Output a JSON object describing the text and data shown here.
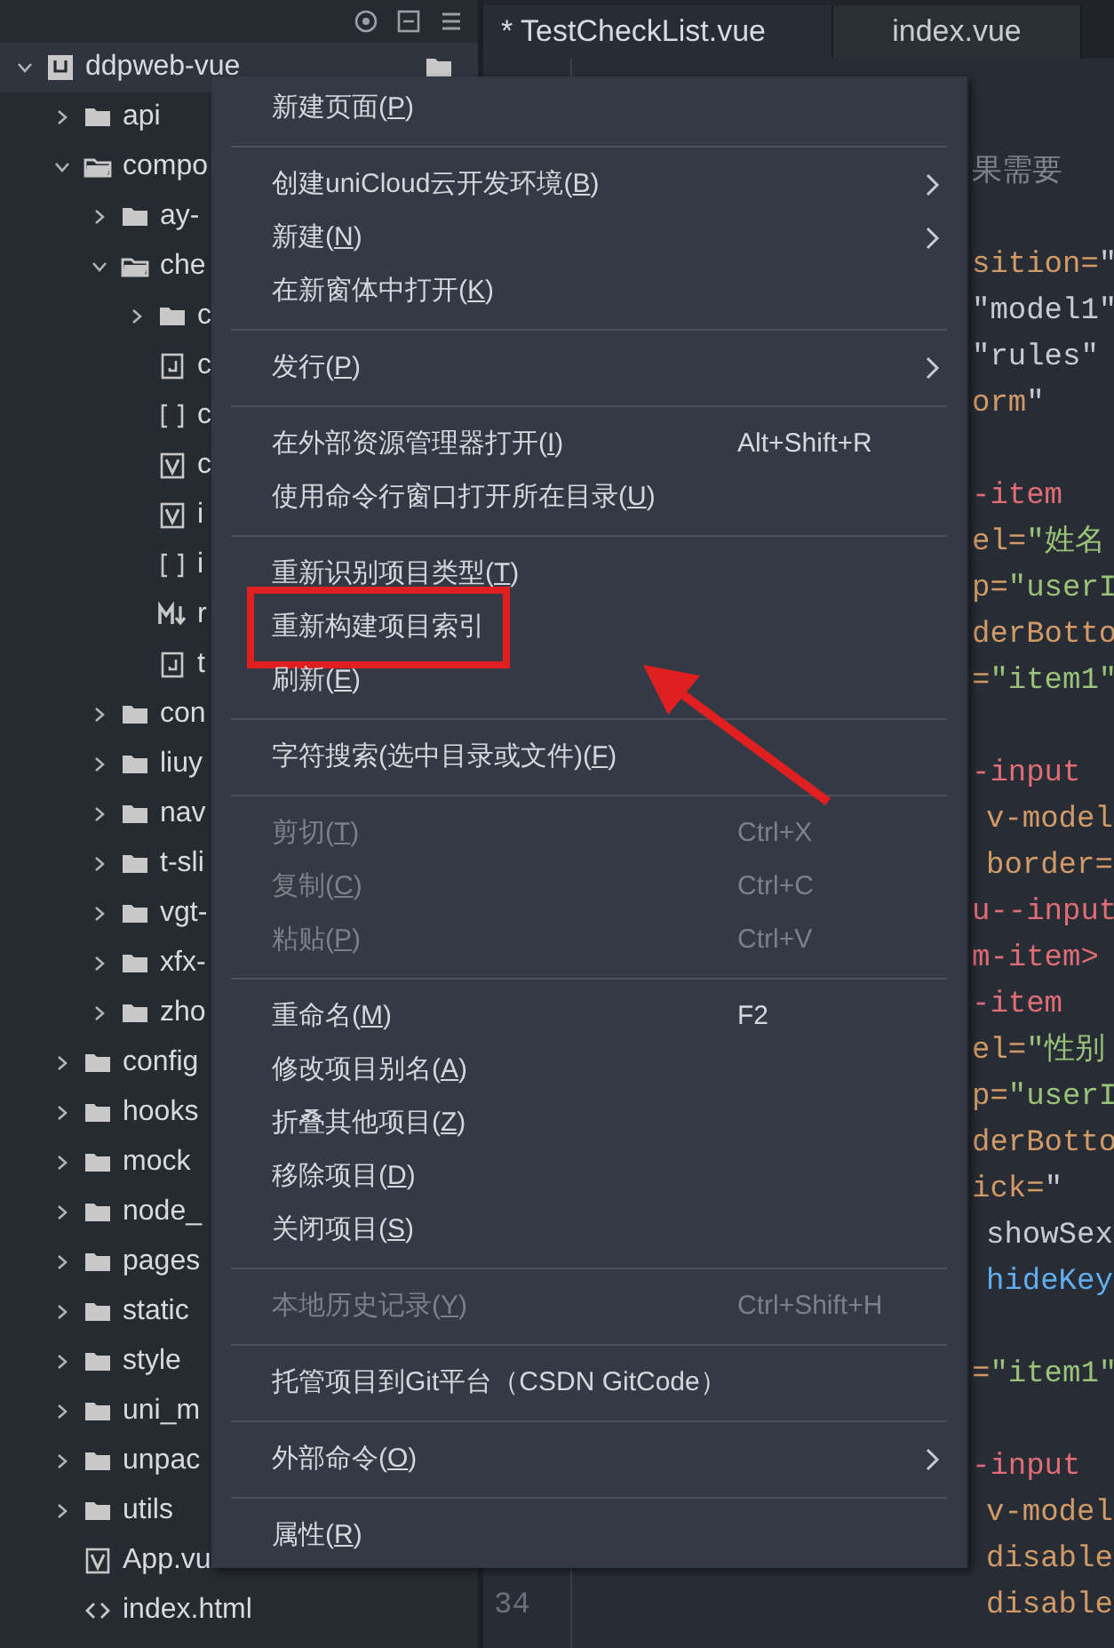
{
  "sidebar": {
    "tree": [
      {
        "label": "ddpweb-vue",
        "kind": "project",
        "expanded": true,
        "selected": true,
        "children": [
          {
            "label": "api",
            "kind": "folder",
            "expanded": false
          },
          {
            "label": "compo",
            "kind": "folder",
            "expanded": true,
            "children": [
              {
                "label": "ay-",
                "kind": "folder",
                "expanded": false
              },
              {
                "label": "che",
                "kind": "folder",
                "expanded": true,
                "children": [
                  {
                    "label": "c",
                    "kind": "folder",
                    "expanded": false
                  },
                  {
                    "label": "c",
                    "kind": "js"
                  },
                  {
                    "label": "c",
                    "kind": "json"
                  },
                  {
                    "label": "c",
                    "kind": "vue"
                  },
                  {
                    "label": "i",
                    "kind": "vue"
                  },
                  {
                    "label": "i",
                    "kind": "json"
                  },
                  {
                    "label": "r",
                    "kind": "markdown"
                  },
                  {
                    "label": "t",
                    "kind": "js"
                  }
                ]
              },
              {
                "label": "con",
                "kind": "folder",
                "expanded": false
              },
              {
                "label": "liuy",
                "kind": "folder",
                "expanded": false
              },
              {
                "label": "nav",
                "kind": "folder",
                "expanded": false
              },
              {
                "label": "t-sli",
                "kind": "folder",
                "expanded": false
              },
              {
                "label": "vgt-",
                "kind": "folder",
                "expanded": false
              },
              {
                "label": "xfx-",
                "kind": "folder",
                "expanded": false
              },
              {
                "label": "zho",
                "kind": "folder",
                "expanded": false
              }
            ]
          },
          {
            "label": "config",
            "kind": "folder",
            "expanded": false
          },
          {
            "label": "hooks",
            "kind": "folder",
            "expanded": false
          },
          {
            "label": "mock",
            "kind": "folder",
            "expanded": false
          },
          {
            "label": "node_",
            "kind": "folder",
            "expanded": false
          },
          {
            "label": "pages",
            "kind": "folder",
            "expanded": false
          },
          {
            "label": "static",
            "kind": "folder",
            "expanded": false
          },
          {
            "label": "style",
            "kind": "folder",
            "expanded": false
          },
          {
            "label": "uni_m",
            "kind": "folder",
            "expanded": false
          },
          {
            "label": "unpac",
            "kind": "folder",
            "expanded": false
          },
          {
            "label": "utils",
            "kind": "folder",
            "expanded": false
          },
          {
            "label": "App.vu",
            "kind": "vue"
          },
          {
            "label": "index.html",
            "kind": "html"
          }
        ]
      }
    ]
  },
  "tabs": [
    {
      "label": "* TestCheckList.vue",
      "selected": true
    },
    {
      "label": "index.vue",
      "selected": false
    }
  ],
  "editor": {
    "blocks": [
      [
        {
          "indented": false,
          "segments": [
            {
              "text": "果需要",
              "kind": "comment"
            }
          ]
        }
      ],
      [
        {
          "indented": false,
          "segments": [
            {
              "text": "sition=",
              "kind": "attr"
            },
            {
              "text": "\"",
              "kind": "plain"
            }
          ]
        },
        {
          "indented": false,
          "segments": [
            {
              "text": "\"model1\"",
              "kind": "plain"
            }
          ]
        },
        {
          "indented": false,
          "segments": [
            {
              "text": "\"rules\"",
              "kind": "plain"
            }
          ]
        },
        {
          "indented": false,
          "segments": [
            {
              "text": "orm",
              "kind": "attr"
            },
            {
              "text": "\"",
              "kind": "plain"
            }
          ]
        }
      ],
      [
        {
          "indented": false,
          "segments": [
            {
              "text": "-item",
              "kind": "tag"
            }
          ]
        },
        {
          "indented": false,
          "segments": [
            {
              "text": "el=",
              "kind": "attr"
            },
            {
              "text": "\"姓名",
              "kind": "string"
            }
          ]
        },
        {
          "indented": false,
          "segments": [
            {
              "text": "p=",
              "kind": "attr"
            },
            {
              "text": "\"userI",
              "kind": "string"
            }
          ]
        },
        {
          "indented": false,
          "segments": [
            {
              "text": "derBotto",
              "kind": "attr"
            }
          ]
        },
        {
          "indented": false,
          "segments": [
            {
              "text": "=",
              "kind": "attr"
            },
            {
              "text": "\"item1\"",
              "kind": "string"
            }
          ]
        }
      ],
      [
        {
          "indented": false,
          "segments": [
            {
              "text": "-input",
              "kind": "tag"
            }
          ]
        },
        {
          "indented": true,
          "segments": [
            {
              "text": "v-model",
              "kind": "attr"
            }
          ]
        },
        {
          "indented": true,
          "segments": [
            {
              "text": "border=",
              "kind": "attr"
            }
          ]
        },
        {
          "indented": false,
          "segments": [
            {
              "text": "u--input",
              "kind": "tag"
            }
          ]
        },
        {
          "indented": false,
          "segments": [
            {
              "text": "m-item>",
              "kind": "tag"
            }
          ]
        },
        {
          "indented": false,
          "segments": [
            {
              "text": "-item",
              "kind": "tag"
            }
          ]
        },
        {
          "indented": false,
          "segments": [
            {
              "text": "el=",
              "kind": "attr"
            },
            {
              "text": "\"性别",
              "kind": "string"
            }
          ]
        },
        {
          "indented": false,
          "segments": [
            {
              "text": "p=",
              "kind": "attr"
            },
            {
              "text": "\"userI",
              "kind": "string"
            }
          ]
        },
        {
          "indented": false,
          "segments": [
            {
              "text": "derBotto",
              "kind": "attr"
            }
          ]
        },
        {
          "indented": false,
          "segments": [
            {
              "text": "ick=",
              "kind": "attr"
            },
            {
              "text": "\"",
              "kind": "plain"
            }
          ]
        },
        {
          "indented": true,
          "segments": [
            {
              "text": "showSex",
              "kind": "plain"
            }
          ]
        },
        {
          "indented": true,
          "segments": [
            {
              "text": "hideKey",
              "kind": "func"
            }
          ]
        }
      ],
      [
        {
          "indented": false,
          "segments": [
            {
              "text": "=",
              "kind": "attr"
            },
            {
              "text": "\"item1\"",
              "kind": "string"
            }
          ]
        }
      ],
      [
        {
          "indented": false,
          "segments": [
            {
              "text": "-input",
              "kind": "tag"
            }
          ]
        },
        {
          "indented": true,
          "segments": [
            {
              "text": "v-model",
              "kind": "attr"
            }
          ]
        },
        {
          "indented": true,
          "segments": [
            {
              "text": "disable",
              "kind": "attr"
            }
          ]
        },
        {
          "number": "34",
          "indented": true,
          "segments": [
            {
              "text": "disable",
              "kind": "attr"
            }
          ]
        }
      ]
    ]
  },
  "context_menu": {
    "groups": [
      [
        {
          "label": "新建页面(P)",
          "disabled": false,
          "submenu": false,
          "highlighted": false
        }
      ],
      [
        {
          "label": "创建uniCloud云开发环境(B)",
          "disabled": false,
          "submenu": true,
          "highlighted": false
        },
        {
          "label": "新建(N)",
          "disabled": false,
          "submenu": true,
          "highlighted": false
        },
        {
          "label": "在新窗体中打开(K)",
          "disabled": false,
          "submenu": false,
          "highlighted": false
        }
      ],
      [
        {
          "label": "发行(P)",
          "disabled": false,
          "submenu": true,
          "highlighted": false
        }
      ],
      [
        {
          "label": "在外部资源管理器打开(I)",
          "shortcut": "Alt+Shift+R",
          "disabled": false,
          "submenu": false,
          "highlighted": false
        },
        {
          "label": "使用命令行窗口打开所在目录(U)",
          "disabled": false,
          "submenu": false,
          "highlighted": false
        }
      ],
      [
        {
          "label": "重新识别项目类型(T)",
          "disabled": false,
          "submenu": false,
          "highlighted": false
        },
        {
          "label": "重新构建项目索引",
          "disabled": false,
          "submenu": false,
          "highlighted": true
        },
        {
          "label": "刷新(E)",
          "disabled": false,
          "submenu": false,
          "highlighted": false
        }
      ],
      [
        {
          "label": "字符搜索(选中目录或文件)(F)",
          "disabled": false,
          "submenu": false,
          "highlighted": false
        }
      ],
      [
        {
          "label": "剪切(T)",
          "shortcut": "Ctrl+X",
          "disabled": true,
          "submenu": false,
          "highlighted": false
        },
        {
          "label": "复制(C)",
          "shortcut": "Ctrl+C",
          "disabled": true,
          "submenu": false,
          "highlighted": false
        },
        {
          "label": "粘贴(P)",
          "shortcut": "Ctrl+V",
          "disabled": true,
          "submenu": false,
          "highlighted": false
        }
      ],
      [
        {
          "label": "重命名(M)",
          "shortcut": "F2",
          "disabled": false,
          "submenu": false,
          "highlighted": false
        },
        {
          "label": "修改项目别名(A)",
          "disabled": false,
          "submenu": false,
          "highlighted": false
        },
        {
          "label": "折叠其他项目(Z)",
          "disabled": false,
          "submenu": false,
          "highlighted": false
        },
        {
          "label": "移除项目(D)",
          "disabled": false,
          "submenu": false,
          "highlighted": false
        },
        {
          "label": "关闭项目(S)",
          "disabled": false,
          "submenu": false,
          "highlighted": false
        }
      ],
      [
        {
          "label": "本地历史记录(Y)",
          "shortcut": "Ctrl+Shift+H",
          "disabled": true,
          "submenu": false,
          "highlighted": false
        }
      ],
      [
        {
          "label": "托管项目到Git平台（CSDN GitCode）",
          "disabled": false,
          "submenu": false,
          "highlighted": false
        }
      ],
      [
        {
          "label": "外部命令(O)",
          "disabled": false,
          "submenu": true,
          "highlighted": false
        }
      ],
      [
        {
          "label": "属性(R)",
          "disabled": false,
          "submenu": false,
          "highlighted": false
        }
      ]
    ]
  }
}
